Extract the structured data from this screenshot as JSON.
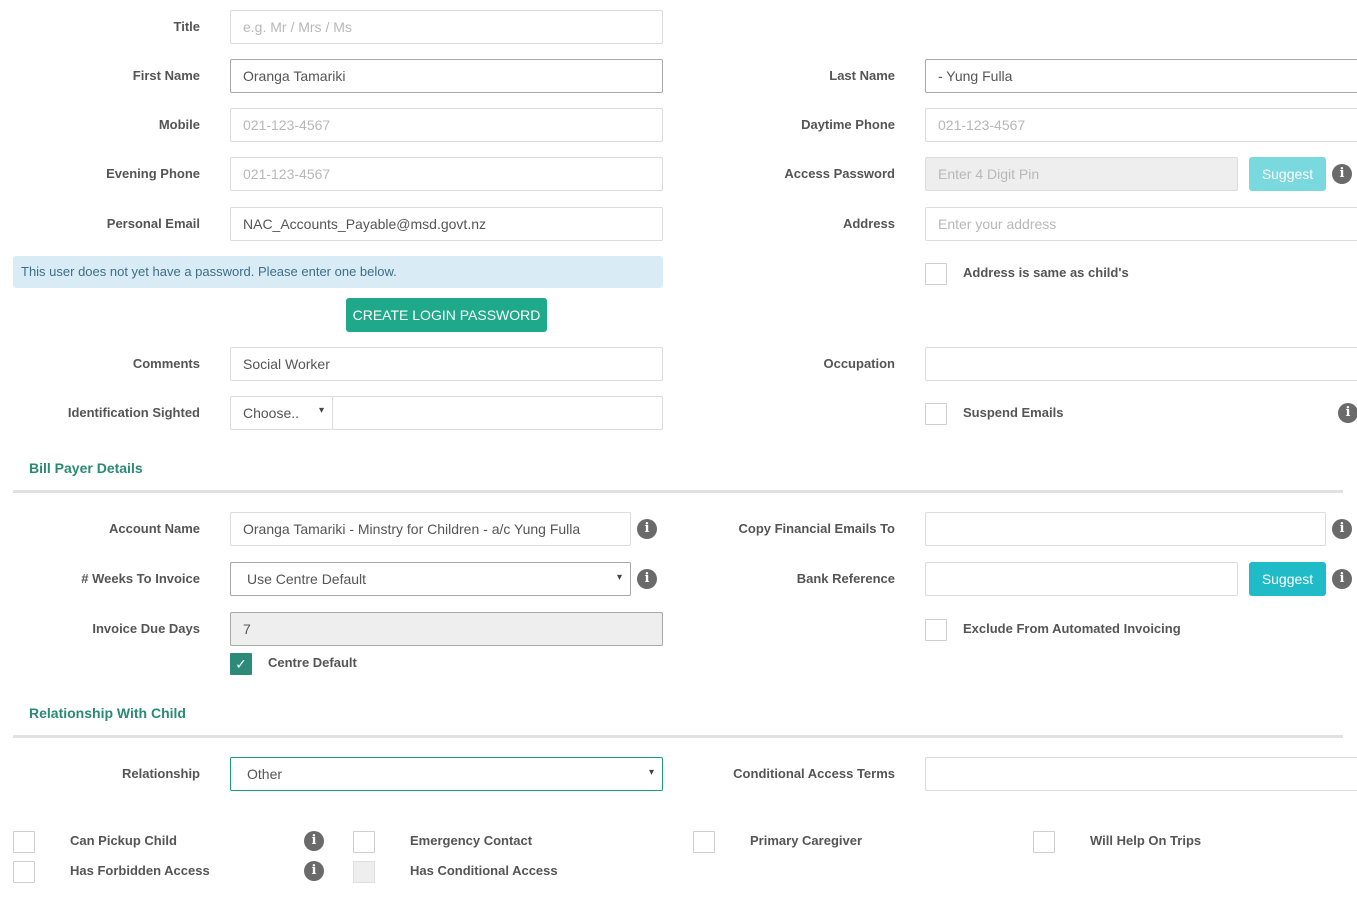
{
  "contact": {
    "title": {
      "label": "Title",
      "placeholder": "e.g. Mr / Mrs / Ms"
    },
    "first_name": {
      "label": "First Name",
      "value": "Oranga Tamariki"
    },
    "last_name": {
      "label": "Last Name",
      "value": "- Yung Fulla"
    },
    "mobile": {
      "label": "Mobile",
      "placeholder": "021-123-4567"
    },
    "daytime_phone": {
      "label": "Daytime Phone",
      "placeholder": "021-123-4567"
    },
    "evening_phone": {
      "label": "Evening Phone",
      "placeholder": "021-123-4567"
    },
    "access_password": {
      "label": "Access Password",
      "placeholder": "Enter 4 Digit Pin",
      "suggest_label": "Suggest"
    },
    "personal_email": {
      "label": "Personal Email",
      "value": "NAC_Accounts_Payable@msd.govt.nz"
    },
    "address": {
      "label": "Address",
      "placeholder": "Enter your address"
    },
    "password_notice": "This user does not yet have a password. Please enter one below.",
    "address_same_label": "Address is same as child's",
    "create_password_label": "CREATE LOGIN PASSWORD",
    "comments": {
      "label": "Comments",
      "value": "Social Worker"
    },
    "occupation": {
      "label": "Occupation",
      "value": ""
    },
    "identification": {
      "label": "Identification Sighted",
      "select_value": "Choose..",
      "value": ""
    },
    "suspend_emails_label": "Suspend Emails"
  },
  "bill_payer": {
    "section_title": "Bill Payer Details",
    "account_name": {
      "label": "Account Name",
      "value": "Oranga Tamariki - Minstry for Children - a/c Yung Fulla"
    },
    "copy_financial": {
      "label": "Copy Financial Emails To",
      "value": ""
    },
    "weeks_to_invoice": {
      "label": "# Weeks To Invoice",
      "value": "Use Centre Default"
    },
    "bank_reference": {
      "label": "Bank Reference",
      "value": "",
      "suggest_label": "Suggest"
    },
    "invoice_due_days": {
      "label": "Invoice Due Days",
      "value": "7"
    },
    "exclude_label": "Exclude From Automated Invoicing",
    "centre_default_label": "Centre Default",
    "centre_default_checked": true
  },
  "relationship": {
    "section_title": "Relationship With Child",
    "relationship": {
      "label": "Relationship",
      "value": "Other"
    },
    "conditional_terms": {
      "label": "Conditional Access Terms",
      "value": ""
    },
    "checkboxes": [
      {
        "label": "Can Pickup Child"
      },
      {
        "label": "Emergency Contact"
      },
      {
        "label": "Primary Caregiver"
      },
      {
        "label": "Will Help On Trips"
      },
      {
        "label": "Has Forbidden Access"
      },
      {
        "label": "Has Conditional Access"
      }
    ]
  },
  "icons": {
    "info": "i",
    "check": "✓",
    "caret": "▾"
  },
  "colors": {
    "accent": "#1ea98a",
    "section_title": "#2b8a74",
    "suggest_disabled": "#7ad8df",
    "suggest": "#1fbcc8",
    "notice_bg": "#d9ecf5",
    "notice_text": "#3d6e8a"
  }
}
